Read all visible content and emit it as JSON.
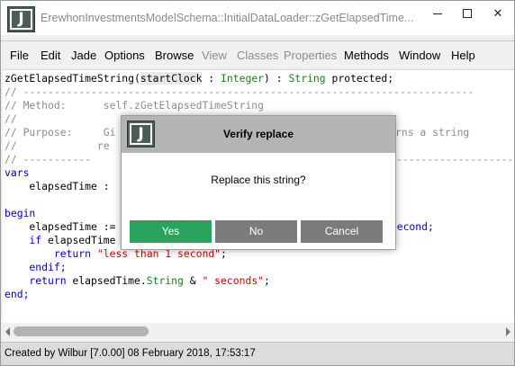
{
  "window": {
    "title": "ErewhonInvestmentsModelSchema::InitialDataLoader::zGetElapsedTime...",
    "logo_letter": "J",
    "controls": {
      "minimize": "minimize-icon",
      "maximize": "maximize-icon",
      "close": "✕"
    }
  },
  "menu": [
    {
      "label": "File",
      "enabled": true
    },
    {
      "label": "Edit",
      "enabled": true
    },
    {
      "label": "Jade",
      "enabled": true
    },
    {
      "label": "Options",
      "enabled": true
    },
    {
      "label": "Browse",
      "enabled": true
    },
    {
      "label": "View",
      "enabled": false
    },
    {
      "label": "Classes",
      "enabled": false
    },
    {
      "label": "Properties",
      "enabled": false
    },
    {
      "label": "Methods",
      "enabled": true
    },
    {
      "label": "Window",
      "enabled": true
    },
    {
      "label": "Help",
      "enabled": true
    }
  ],
  "code": {
    "l1": {
      "a": "zGetElapsedTimeString(",
      "b": "startClock",
      "c": " : ",
      "d": "Integer",
      "e": ") : ",
      "f": "String",
      "g": " protected;"
    },
    "l2": "// -------------------------------------------------------------------------",
    "l3": "// Method:      self.zGetElapsedTimeString",
    "l4": "//",
    "l5a": "// Purpose:     Gi",
    "l5b": "rns a string",
    "l6": "//             re",
    "l7": "// -----------",
    "l7b": "-------------------",
    "l8": "vars",
    "l9": "    elapsedTime : ",
    "l10": "",
    "l11": "begin",
    "l12a": "    elapsedTime :=",
    "l12b": "rSecond;",
    "l13a": "    if elapsedTime",
    "l14a": "        return ",
    "l14b": "\"less than 1 second\"",
    "l14c": ";",
    "l15": "    endif;",
    "l16a": "    return elapsedTime.",
    "l16b": "String",
    "l16c": " & ",
    "l16d": "\" seconds\"",
    "l16e": ";",
    "l17": "end;"
  },
  "status": "Created by Wilbur [7.0.00] 08 February 2018, 17:53:17",
  "dialog": {
    "logo_letter": "J",
    "title": "Verify replace",
    "message": "Replace this string?",
    "buttons": {
      "yes": "Yes",
      "no": "No",
      "cancel": "Cancel"
    }
  },
  "colors": {
    "accent_yes": "#27a35c",
    "button_gray": "#7b7b7b",
    "logo": "#4d5c55",
    "keyword": "#0000cc",
    "type": "#1a7f1a",
    "comment": "#8c8c8c",
    "string": "#cc0000"
  }
}
